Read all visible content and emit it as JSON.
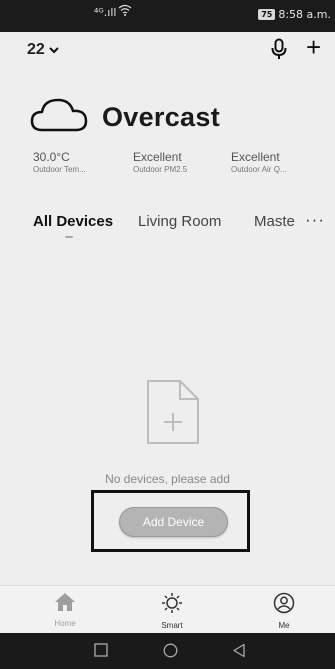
{
  "status_bar": {
    "signal": "⁴ᴳ.ıll",
    "battery": "75",
    "time": "8:58 a.m."
  },
  "header": {
    "home_name": "22",
    "chevron": "chevron-down-icon",
    "mic": "microphone-icon",
    "add": "+"
  },
  "weather": {
    "condition": "Overcast",
    "icon": "cloud-icon",
    "metrics": [
      {
        "value": "30.0°C",
        "label": "Outdoor Tem..."
      },
      {
        "value": "Excellent",
        "label": "Outdoor PM2.5"
      },
      {
        "value": "Excellent",
        "label": "Outdoor Air Q..."
      }
    ]
  },
  "rooms": {
    "tabs": [
      "All Devices",
      "Living Room",
      "Maste"
    ],
    "active": "All Devices",
    "more": "···"
  },
  "empty_state": {
    "icon": "add-file-icon",
    "message": "No devices, please add",
    "button_label": "Add Device"
  },
  "bottom_nav": {
    "items": [
      {
        "label": "Home",
        "icon": "home-icon",
        "color": "#9e9e9e"
      },
      {
        "label": "Smart",
        "icon": "sun-icon",
        "color": "#333333"
      },
      {
        "label": "Me",
        "icon": "profile-icon",
        "color": "#333333"
      }
    ]
  },
  "system_nav": [
    "square-icon",
    "circle-icon",
    "triangle-back-icon"
  ],
  "colors": {
    "background": "#eeeeee",
    "status_bar": "#1b1b1b",
    "button": "#b4b4b4",
    "highlight_border": "#111111"
  }
}
